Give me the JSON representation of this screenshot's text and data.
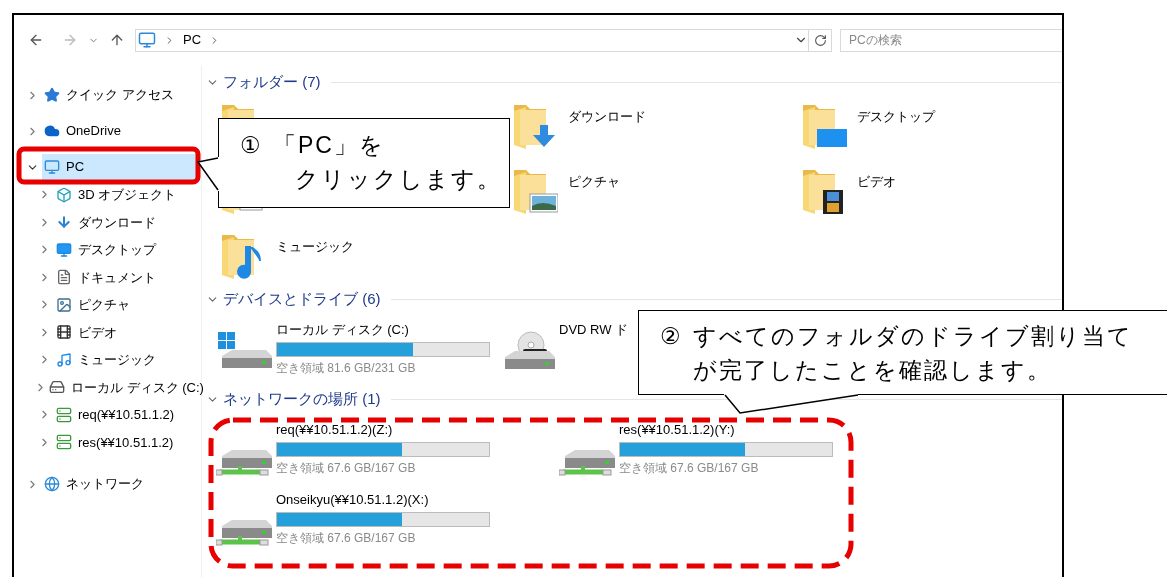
{
  "address_bar": {
    "segments": [
      "PC"
    ]
  },
  "search": {
    "placeholder": "PCの検索"
  },
  "sidebar": {
    "items": [
      {
        "label": "クイック アクセス",
        "kind": "quick",
        "selected": false,
        "expanded": false
      },
      {
        "label": "OneDrive",
        "kind": "cloud",
        "selected": false,
        "expanded": false
      },
      {
        "label": "PC",
        "kind": "pc",
        "selected": true,
        "expanded": true,
        "children": [
          {
            "label": "3D オブジェクト",
            "kind": "objects",
            "selected": false,
            "expanded": false
          },
          {
            "label": "ダウンロード",
            "kind": "download",
            "selected": false,
            "expanded": false
          },
          {
            "label": "デスクトップ",
            "kind": "desktop",
            "selected": false,
            "expanded": false
          },
          {
            "label": "ドキュメント",
            "kind": "documents",
            "selected": false,
            "expanded": false
          },
          {
            "label": "ピクチャ",
            "kind": "pictures",
            "selected": false,
            "expanded": false
          },
          {
            "label": "ビデオ",
            "kind": "videos",
            "selected": false,
            "expanded": false
          },
          {
            "label": "ミュージック",
            "kind": "music",
            "selected": false,
            "expanded": false
          },
          {
            "label": "ローカル ディスク (C:)",
            "kind": "disk",
            "selected": false,
            "expanded": false
          },
          {
            "label": "req(¥¥10.51.1.2)",
            "kind": "netdrive",
            "selected": false,
            "expanded": false
          },
          {
            "label": "res(¥¥10.51.1.2)",
            "kind": "netdrive",
            "selected": false,
            "expanded": false
          }
        ]
      },
      {
        "label": "ネットワーク",
        "kind": "network",
        "selected": false,
        "expanded": false
      }
    ]
  },
  "sections": [
    {
      "title": "フォルダー (7)",
      "kind": "folders",
      "expanded": true,
      "items": [
        {
          "kind": "objects"
        },
        {
          "label": "ダウンロード",
          "kind": "download"
        },
        {
          "label": "デスクトップ",
          "kind": "desktop"
        },
        {
          "kind": "documents"
        },
        {
          "label": "ピクチャ",
          "kind": "pictures"
        },
        {
          "label": "ビデオ",
          "kind": "videos"
        },
        {
          "label": "ミュージック",
          "kind": "music"
        }
      ]
    },
    {
      "title": "デバイスとドライブ (6)",
      "kind": "drives",
      "expanded": true,
      "items": [
        {
          "name": "ローカル ディスク (C:)",
          "kind": "system",
          "level": 0.64,
          "free": "空き領域 81.6 GB/231 GB"
        },
        {
          "name": "DVD RW ド",
          "kind": "dvd"
        }
      ]
    },
    {
      "title": "ネットワークの場所 (1)",
      "kind": "network",
      "expanded": true,
      "items": [
        {
          "name": "req(¥¥10.51.1.2)(Z:)",
          "kind": "network",
          "level": 0.59,
          "free": "空き領域 67.6 GB/167 GB"
        },
        {
          "name": "res(¥¥10.51.1.2)(Y:)",
          "kind": "network",
          "level": 0.59,
          "free": "空き領域 67.6 GB/167 GB"
        },
        {
          "name": "Onseikyu(¥¥10.51.1.2)(X:)",
          "kind": "network",
          "level": 0.59,
          "free": "空き領域 67.6 GB/167 GB"
        }
      ]
    }
  ],
  "callouts": [
    {
      "number": "①",
      "lines": [
        "「PC」を",
        "クリックします。"
      ]
    },
    {
      "number": "②",
      "lines": [
        "すべてのフォルダのドライブ割り当て",
        "が完了したことを確認します。"
      ]
    }
  ]
}
